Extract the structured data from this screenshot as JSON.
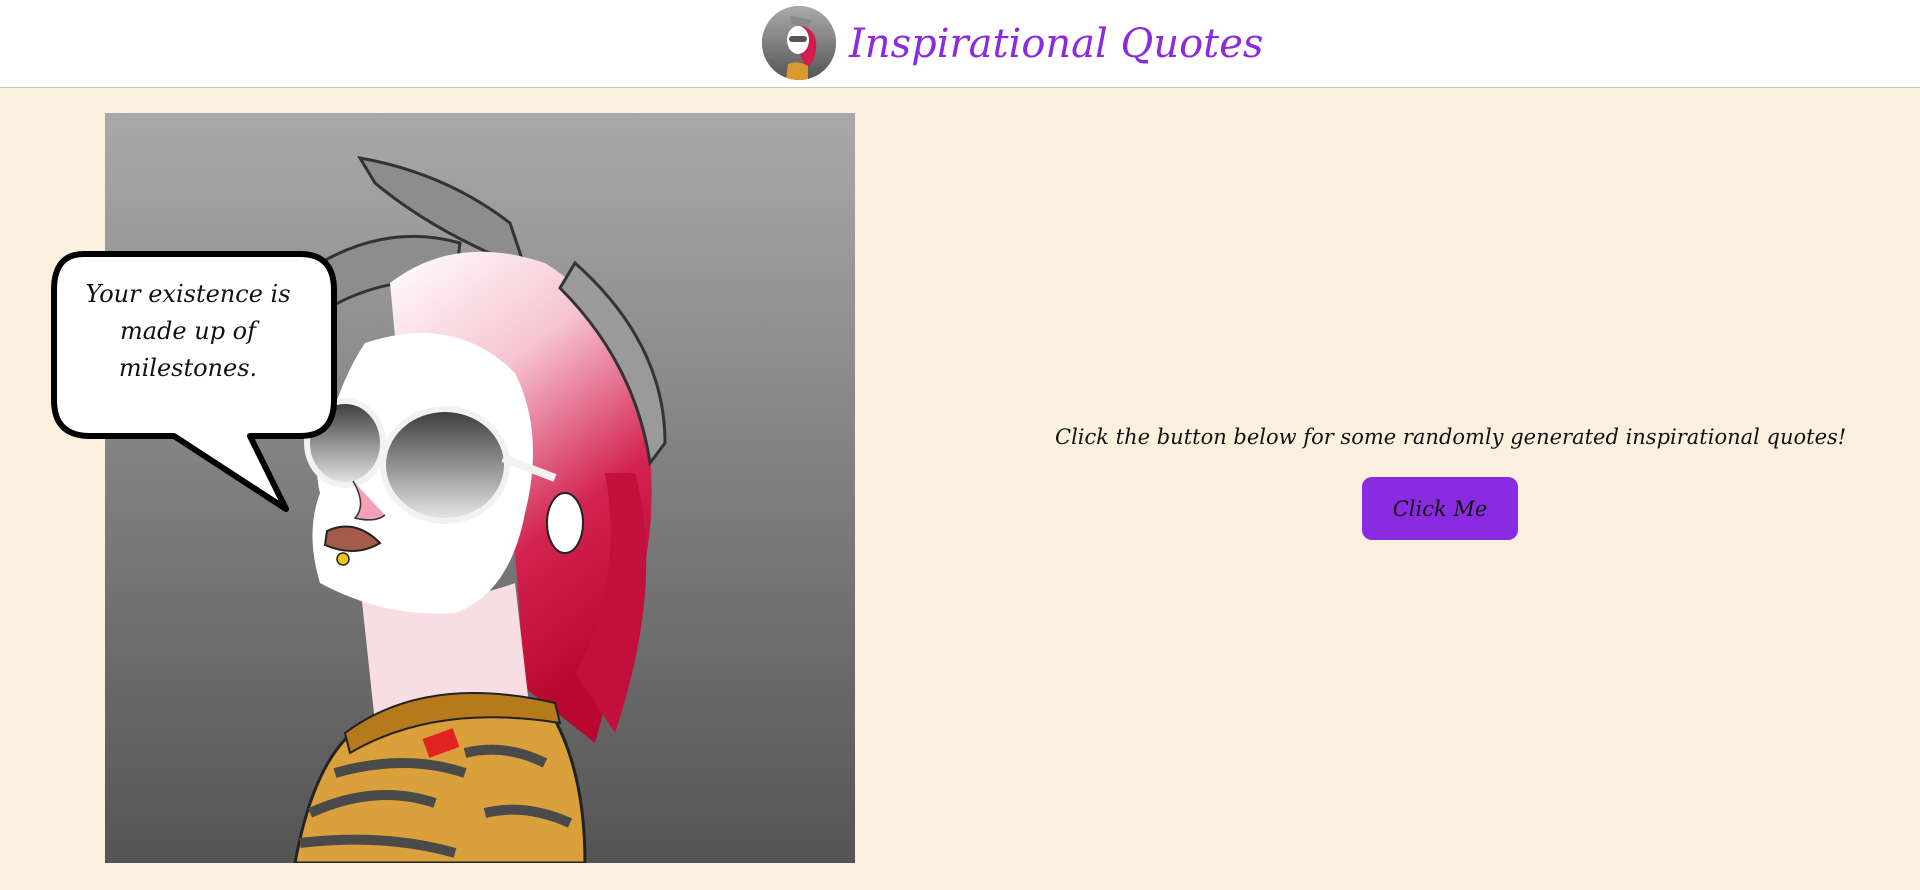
{
  "header": {
    "title": "Inspirational Quotes",
    "logo_icon": "portrait-avatar-icon"
  },
  "main": {
    "quote_bubble": {
      "text": "Your existence is made up of milestones."
    },
    "prompt_text": "Click the button below for some randomly generated inspirational quotes!",
    "button_label": "Click Me"
  },
  "colors": {
    "accent": "#8a2be2",
    "background": "#fbefde",
    "header_bg": "#ffffff",
    "hair_pink": "#c8103c"
  }
}
